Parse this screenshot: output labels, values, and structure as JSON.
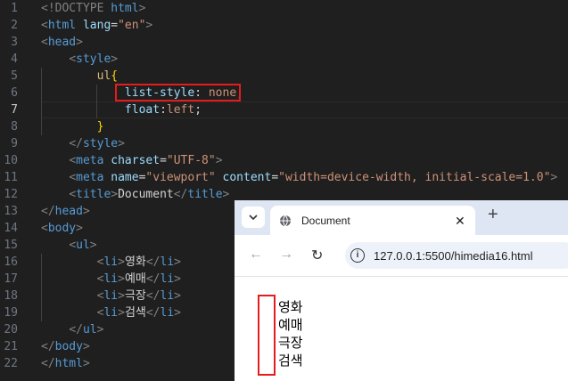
{
  "editor": {
    "line_numbers": [
      "1",
      "2",
      "3",
      "4",
      "5",
      "6",
      "7",
      "8",
      "9",
      "10",
      "11",
      "12",
      "13",
      "14",
      "15",
      "16",
      "17",
      "18",
      "19",
      "20",
      "21",
      "22"
    ],
    "lines": [
      [
        {
          "c": "tg",
          "t": "<!DOCTYPE "
        },
        {
          "c": "tn",
          "t": "html"
        },
        {
          "c": "tg",
          "t": ">"
        }
      ],
      [
        {
          "c": "tg",
          "t": "<"
        },
        {
          "c": "tn",
          "t": "html"
        },
        {
          "c": "tx",
          "t": " "
        },
        {
          "c": "at",
          "t": "lang"
        },
        {
          "c": "tx",
          "t": "="
        },
        {
          "c": "av",
          "t": "\"en\""
        },
        {
          "c": "tg",
          "t": ">"
        }
      ],
      [
        {
          "c": "tg",
          "t": "<"
        },
        {
          "c": "tn",
          "t": "head"
        },
        {
          "c": "tg",
          "t": ">"
        }
      ],
      [
        {
          "c": "tx",
          "t": "    "
        },
        {
          "c": "tg",
          "t": "<"
        },
        {
          "c": "tn",
          "t": "style"
        },
        {
          "c": "tg",
          "t": ">"
        }
      ],
      [
        {
          "c": "tx",
          "t": "        "
        },
        {
          "c": "sel",
          "t": "ul"
        },
        {
          "c": "br",
          "t": "{"
        }
      ],
      [
        {
          "c": "tx",
          "t": "            "
        },
        {
          "c": "pr",
          "t": "list-style"
        },
        {
          "c": "tx",
          "t": ": "
        },
        {
          "c": "av",
          "t": "none"
        },
        {
          "c": "tx",
          "t": ";"
        }
      ],
      [
        {
          "c": "tx",
          "t": "            "
        },
        {
          "c": "pr",
          "t": "float"
        },
        {
          "c": "tx",
          "t": ":"
        },
        {
          "c": "av",
          "t": "left"
        },
        {
          "c": "tx",
          "t": ";"
        }
      ],
      [
        {
          "c": "tx",
          "t": "        "
        },
        {
          "c": "br",
          "t": "}"
        }
      ],
      [
        {
          "c": "tx",
          "t": "    "
        },
        {
          "c": "tg",
          "t": "</"
        },
        {
          "c": "tn",
          "t": "style"
        },
        {
          "c": "tg",
          "t": ">"
        }
      ],
      [
        {
          "c": "tx",
          "t": "    "
        },
        {
          "c": "tg",
          "t": "<"
        },
        {
          "c": "tn",
          "t": "meta"
        },
        {
          "c": "tx",
          "t": " "
        },
        {
          "c": "at",
          "t": "charset"
        },
        {
          "c": "tx",
          "t": "="
        },
        {
          "c": "av",
          "t": "\"UTF-8\""
        },
        {
          "c": "tg",
          "t": ">"
        }
      ],
      [
        {
          "c": "tx",
          "t": "    "
        },
        {
          "c": "tg",
          "t": "<"
        },
        {
          "c": "tn",
          "t": "meta"
        },
        {
          "c": "tx",
          "t": " "
        },
        {
          "c": "at",
          "t": "name"
        },
        {
          "c": "tx",
          "t": "="
        },
        {
          "c": "av",
          "t": "\"viewport\""
        },
        {
          "c": "tx",
          "t": " "
        },
        {
          "c": "at",
          "t": "content"
        },
        {
          "c": "tx",
          "t": "="
        },
        {
          "c": "av",
          "t": "\"width=device-width, initial-scale=1.0\""
        },
        {
          "c": "tg",
          "t": ">"
        }
      ],
      [
        {
          "c": "tx",
          "t": "    "
        },
        {
          "c": "tg",
          "t": "<"
        },
        {
          "c": "tn",
          "t": "title"
        },
        {
          "c": "tg",
          "t": ">"
        },
        {
          "c": "tx",
          "t": "Document"
        },
        {
          "c": "tg",
          "t": "</"
        },
        {
          "c": "tn",
          "t": "title"
        },
        {
          "c": "tg",
          "t": ">"
        }
      ],
      [
        {
          "c": "tg",
          "t": "</"
        },
        {
          "c": "tn",
          "t": "head"
        },
        {
          "c": "tg",
          "t": ">"
        }
      ],
      [
        {
          "c": "tg",
          "t": "<"
        },
        {
          "c": "tn",
          "t": "body"
        },
        {
          "c": "tg",
          "t": ">"
        }
      ],
      [
        {
          "c": "tx",
          "t": "    "
        },
        {
          "c": "tg",
          "t": "<"
        },
        {
          "c": "tn",
          "t": "ul"
        },
        {
          "c": "tg",
          "t": ">"
        }
      ],
      [
        {
          "c": "tx",
          "t": "        "
        },
        {
          "c": "tg",
          "t": "<"
        },
        {
          "c": "tn",
          "t": "li"
        },
        {
          "c": "tg",
          "t": ">"
        },
        {
          "c": "tx",
          "t": "영화"
        },
        {
          "c": "tg",
          "t": "</"
        },
        {
          "c": "tn",
          "t": "li"
        },
        {
          "c": "tg",
          "t": ">"
        }
      ],
      [
        {
          "c": "tx",
          "t": "        "
        },
        {
          "c": "tg",
          "t": "<"
        },
        {
          "c": "tn",
          "t": "li"
        },
        {
          "c": "tg",
          "t": ">"
        },
        {
          "c": "tx",
          "t": "예매"
        },
        {
          "c": "tg",
          "t": "</"
        },
        {
          "c": "tn",
          "t": "li"
        },
        {
          "c": "tg",
          "t": ">"
        }
      ],
      [
        {
          "c": "tx",
          "t": "        "
        },
        {
          "c": "tg",
          "t": "<"
        },
        {
          "c": "tn",
          "t": "li"
        },
        {
          "c": "tg",
          "t": ">"
        },
        {
          "c": "tx",
          "t": "극장"
        },
        {
          "c": "tg",
          "t": "</"
        },
        {
          "c": "tn",
          "t": "li"
        },
        {
          "c": "tg",
          "t": ">"
        }
      ],
      [
        {
          "c": "tx",
          "t": "        "
        },
        {
          "c": "tg",
          "t": "<"
        },
        {
          "c": "tn",
          "t": "li"
        },
        {
          "c": "tg",
          "t": ">"
        },
        {
          "c": "tx",
          "t": "검색"
        },
        {
          "c": "tg",
          "t": "</"
        },
        {
          "c": "tn",
          "t": "li"
        },
        {
          "c": "tg",
          "t": ">"
        }
      ],
      [
        {
          "c": "tx",
          "t": "    "
        },
        {
          "c": "tg",
          "t": "</"
        },
        {
          "c": "tn",
          "t": "ul"
        },
        {
          "c": "tg",
          "t": ">"
        }
      ],
      [
        {
          "c": "tg",
          "t": "</"
        },
        {
          "c": "tn",
          "t": "body"
        },
        {
          "c": "tg",
          "t": ">"
        }
      ],
      [
        {
          "c": "tg",
          "t": "</"
        },
        {
          "c": "tn",
          "t": "html"
        },
        {
          "c": "tg",
          "t": ">"
        }
      ]
    ],
    "active_line_index": 6,
    "highlight_color": "#e51c1c"
  },
  "browser": {
    "tab_title": "Document",
    "close_icon": "close-icon",
    "new_tab_icon": "plus-icon",
    "url": "127.0.0.1:5500/himedia16.html",
    "list_items": [
      "영화",
      "예매",
      "극장",
      "검색"
    ]
  }
}
